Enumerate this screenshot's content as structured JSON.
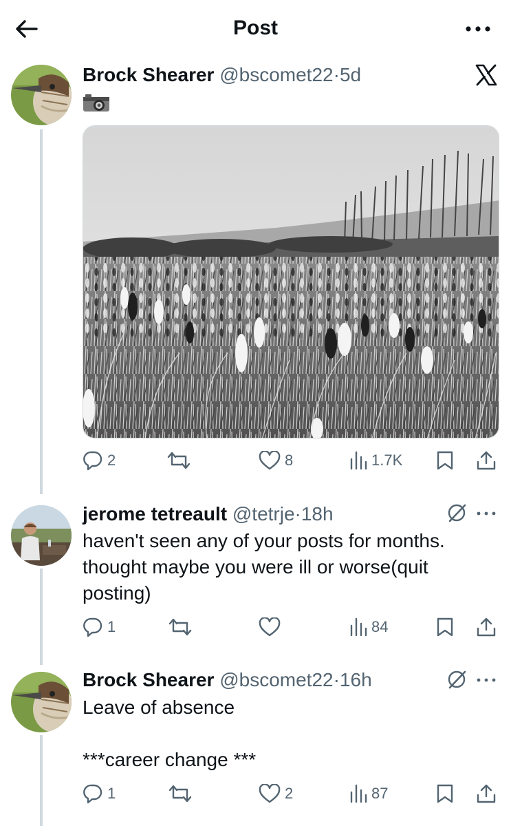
{
  "header": {
    "title": "Post"
  },
  "main_post": {
    "name": "Brock Shearer",
    "handle": "@bscomet22",
    "dot": "·",
    "time": "5d",
    "text": "📷",
    "stats": {
      "replies": "2",
      "reposts": "",
      "likes": "8",
      "views": "1.7K"
    }
  },
  "replies": [
    {
      "name": "jerome tetreault",
      "handle": "@tetrje",
      "dot": "·",
      "time": "18h",
      "text": "haven't seen any of your posts for months. thought maybe you were ill or worse(quit posting)",
      "stats": {
        "replies": "1",
        "reposts": "",
        "likes": "",
        "views": "84"
      }
    },
    {
      "name": "Brock Shearer",
      "handle": "@bscomet22",
      "dot": "·",
      "time": "16h",
      "text": "Leave of absence\n\n***career change ***",
      "stats": {
        "replies": "1",
        "reposts": "",
        "likes": "2",
        "views": "87"
      }
    }
  ],
  "colors": {
    "text": "#0f1419",
    "secondary": "#536471",
    "thread": "#cfd9de"
  },
  "icons": [
    "back-arrow-icon",
    "more-icon",
    "x-logo-icon",
    "camera-icon",
    "reply-icon",
    "repost-icon",
    "like-icon",
    "views-icon",
    "bookmark-icon",
    "share-icon",
    "grok-icon"
  ]
}
